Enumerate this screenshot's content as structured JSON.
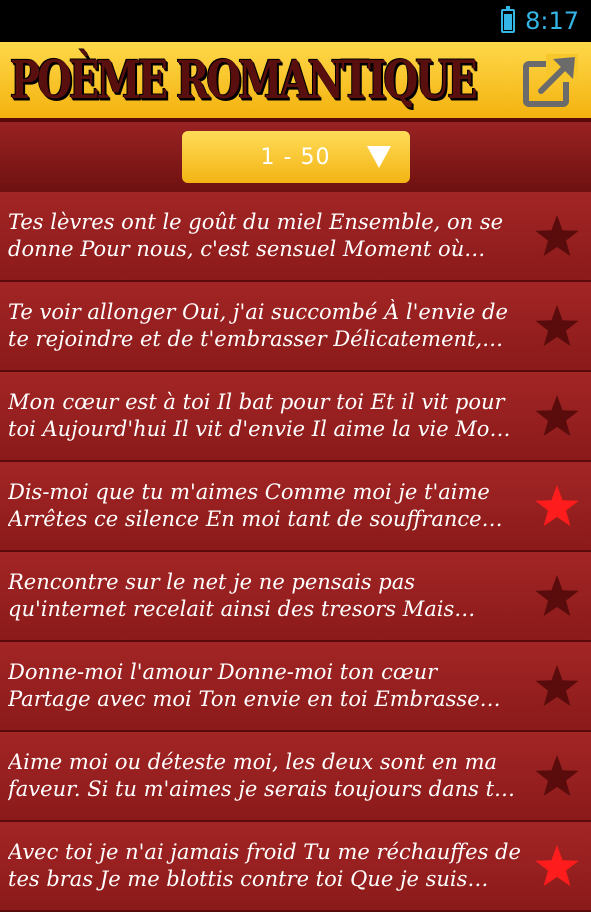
{
  "status": {
    "time": "8:17"
  },
  "app_bar": {
    "title": "POÈME ROMANTIQUE",
    "share_icon": "share-icon"
  },
  "filter": {
    "range": "1 - 50"
  },
  "colors": {
    "favorite_on": "#ff1c1c",
    "favorite_off": "#5a0c0c",
    "accent": "#f3b20e"
  },
  "poems": [
    {
      "text": "Tes lèvres ont le goût du miel Ensemble, on se donne Pour nous, c'est sensuel Moment où…",
      "favorite": false
    },
    {
      "text": "Te voir allonger Oui, j'ai succombé À l'envie de te rejoindre et de t'embrasser Délicatement, je…",
      "favorite": false
    },
    {
      "text": "Mon cœur est à toi Il bat pour toi Et il vit pour toi Aujourd'hui Il vit d'envie Il aime la vie Mo…",
      "favorite": false
    },
    {
      "text": "Dis-moi que tu m'aimes Comme moi je t'aime Arrêtes ce silence En moi tant de souffrance Je…",
      "favorite": true
    },
    {
      "text": "Rencontre sur le net je ne pensais pas qu'internet recelait ainsi des tresors Mais…",
      "favorite": false
    },
    {
      "text": "Donne-moi l'amour Donne-moi ton cœur Partage avec moi Ton envie en toi Embrasse…",
      "favorite": false
    },
    {
      "text": "Aime moi ou déteste moi, les deux sont en ma faveur. Si tu m'aimes je serais toujours dans t…",
      "favorite": false
    },
    {
      "text": "Avec toi je n'ai jamais froid Tu me réchauffes de tes bras Je me blottis contre toi Que je suis bie…",
      "favorite": true
    }
  ]
}
